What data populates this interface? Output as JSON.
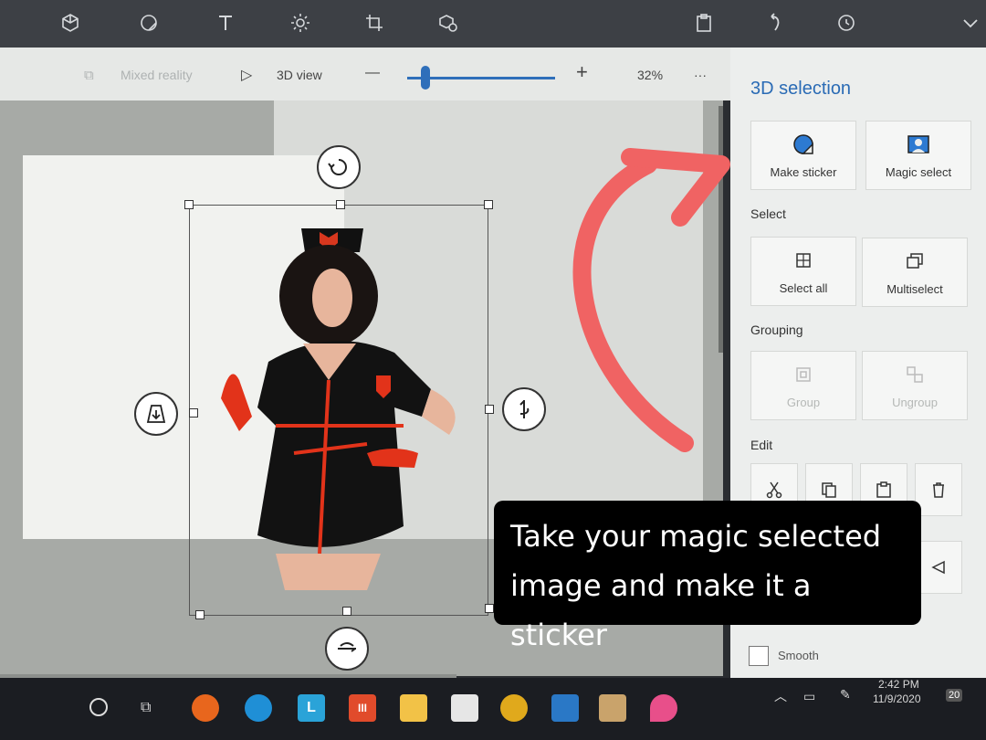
{
  "toolbar": {
    "icons": [
      "brushes-icon",
      "3d-shapes-icon",
      "stickers-icon",
      "text-icon",
      "effects-icon",
      "canvas-icon",
      "3d-library-icon",
      "paste-icon",
      "undo-icon",
      "history-icon",
      "expand-icon"
    ]
  },
  "subbar": {
    "mixed_reality": "Mixed reality",
    "view_3d": "3D view",
    "zoom_minus": "—",
    "zoom_plus": "+",
    "zoom_value": "32%",
    "more": "···"
  },
  "panel": {
    "title": "3D selection",
    "make_sticker": "Make sticker",
    "magic_select": "Magic select",
    "select_label": "Select",
    "select_all": "Select all",
    "multiselect": "Multiselect",
    "grouping_label": "Grouping",
    "group": "Group",
    "ungroup": "Ungroup",
    "edit_label": "Edit",
    "smooth": "Smooth"
  },
  "caption": {
    "line1": "Take your magic selected",
    "line2": "image and make it a sticker"
  },
  "taskbar": {
    "time": "2:42 PM",
    "date": "11/9/2020",
    "notifications": "20",
    "apps": [
      {
        "name": "firefox",
        "color": "#e8661d"
      },
      {
        "name": "edge",
        "color": "#1f8fd6"
      },
      {
        "name": "l-app",
        "color": "#2aa3d8",
        "glyph": "L"
      },
      {
        "name": "red-app",
        "color": "#e14b2b",
        "glyph": "III"
      },
      {
        "name": "explorer",
        "color": "#f2c247"
      },
      {
        "name": "store",
        "color": "#e6e6e6"
      },
      {
        "name": "chrome",
        "color": "#e0a91c"
      },
      {
        "name": "mail",
        "color": "#2a78c6"
      },
      {
        "name": "paint",
        "color": "#c9a36b"
      },
      {
        "name": "paint-3d",
        "color": "#e84f8a"
      }
    ]
  },
  "colors": {
    "accent": "#2a6bb5",
    "arrow": "#f06363"
  }
}
